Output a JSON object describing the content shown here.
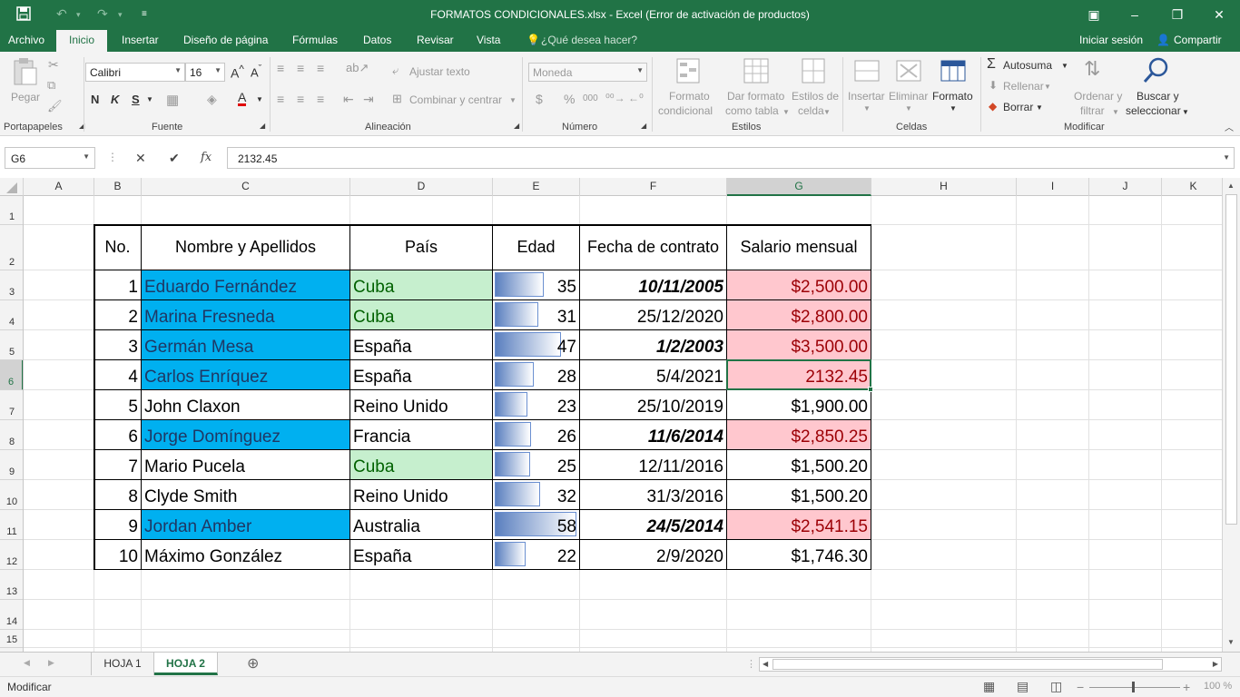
{
  "window": {
    "title": "FORMATOS CONDICIONALES.xlsx - Excel (Error de activación de productos)",
    "accent": "#217346"
  },
  "ribbon_tabs": [
    "Archivo",
    "Inicio",
    "Insertar",
    "Diseño de página",
    "Fórmulas",
    "Datos",
    "Revisar",
    "Vista",
    "¿Qué desea hacer?"
  ],
  "account": {
    "signin": "Iniciar sesión",
    "share": "Compartir"
  },
  "ribbon": {
    "portapapeles": {
      "paste": "Pegar",
      "label": "Portapapeles"
    },
    "fuente": {
      "font": "Calibri",
      "size": "16",
      "bold": "N",
      "italic": "K",
      "underline": "S",
      "label": "Fuente"
    },
    "alineacion": {
      "wrap": "Ajustar texto",
      "merge": "Combinar y centrar",
      "label": "Alineación"
    },
    "numero": {
      "format": "Moneda",
      "label": "Número",
      "currency": "$",
      "percent": "%",
      "thousands": "000"
    },
    "estilos": {
      "cond1": "Formato",
      "cond2": "condicional",
      "table1": "Dar formato",
      "table2": "como tabla",
      "cell1": "Estilos de",
      "cell2": "celda",
      "label": "Estilos"
    },
    "celdas": {
      "insert": "Insertar",
      "delete": "Eliminar",
      "format": "Formato",
      "label": "Celdas"
    },
    "modificar": {
      "autosum": "Autosuma",
      "fill": "Rellenar",
      "clear": "Borrar",
      "sort1": "Ordenar y",
      "sort2": "filtrar",
      "find1": "Buscar y",
      "find2": "seleccionar",
      "label": "Modificar"
    }
  },
  "formula_bar": {
    "name_box": "G6",
    "formula": "2132.45",
    "fx": "fx"
  },
  "columns": [
    "A",
    "B",
    "C",
    "D",
    "E",
    "F",
    "G",
    "H",
    "I",
    "J",
    "K"
  ],
  "rows": [
    "1",
    "2",
    "3",
    "4",
    "5",
    "6",
    "7",
    "8",
    "9",
    "10",
    "11",
    "12",
    "13",
    "14",
    "15"
  ],
  "table": {
    "headers": [
      "No.",
      "Nombre y Apellidos",
      "País",
      "Edad",
      "Fecha de contrato",
      "Salario mensual"
    ],
    "rows": [
      {
        "no": "1",
        "name": "Eduardo Fernández",
        "country": "Cuba",
        "age": "35",
        "age_value": 35,
        "date": "10/11/2005",
        "salary": "$2,500.00"
      },
      {
        "no": "2",
        "name": "Marina Fresneda",
        "country": "Cuba",
        "age": "31",
        "age_value": 31,
        "date": "25/12/2020",
        "salary": "$2,800.00"
      },
      {
        "no": "3",
        "name": "Germán Mesa",
        "country": "España",
        "age": "47",
        "age_value": 47,
        "date": "1/2/2003",
        "salary": "$3,500.00"
      },
      {
        "no": "4",
        "name": "Carlos Enríquez",
        "country": "España",
        "age": "28",
        "age_value": 28,
        "date": "5/4/2021",
        "salary": "2132.45"
      },
      {
        "no": "5",
        "name": "John Claxon",
        "country": "Reino Unido",
        "age": "23",
        "age_value": 23,
        "date": "25/10/2019",
        "salary": "$1,900.00"
      },
      {
        "no": "6",
        "name": "Jorge Domínguez",
        "country": "Francia",
        "age": "26",
        "age_value": 26,
        "date": "11/6/2014",
        "salary": "$2,850.25"
      },
      {
        "no": "7",
        "name": "Mario Pucela",
        "country": "Cuba",
        "age": "25",
        "age_value": 25,
        "date": "12/11/2016",
        "salary": "$1,500.20"
      },
      {
        "no": "8",
        "name": "Clyde Smith",
        "country": "Reino Unido",
        "age": "32",
        "age_value": 32,
        "date": "31/3/2016",
        "salary": "$1,500.20"
      },
      {
        "no": "9",
        "name": "Jordan Amber",
        "country": "Australia",
        "age": "58",
        "age_value": 58,
        "date": "24/5/2014",
        "salary": "$2,541.15"
      },
      {
        "no": "10",
        "name": "Máximo González",
        "country": "España",
        "age": "22",
        "age_value": 22,
        "date": "2/9/2020",
        "salary": "$1,746.30"
      }
    ]
  },
  "sheets": [
    "HOJA 1",
    "HOJA 2"
  ],
  "status": {
    "mode": "Modificar",
    "zoom": "100 %"
  }
}
